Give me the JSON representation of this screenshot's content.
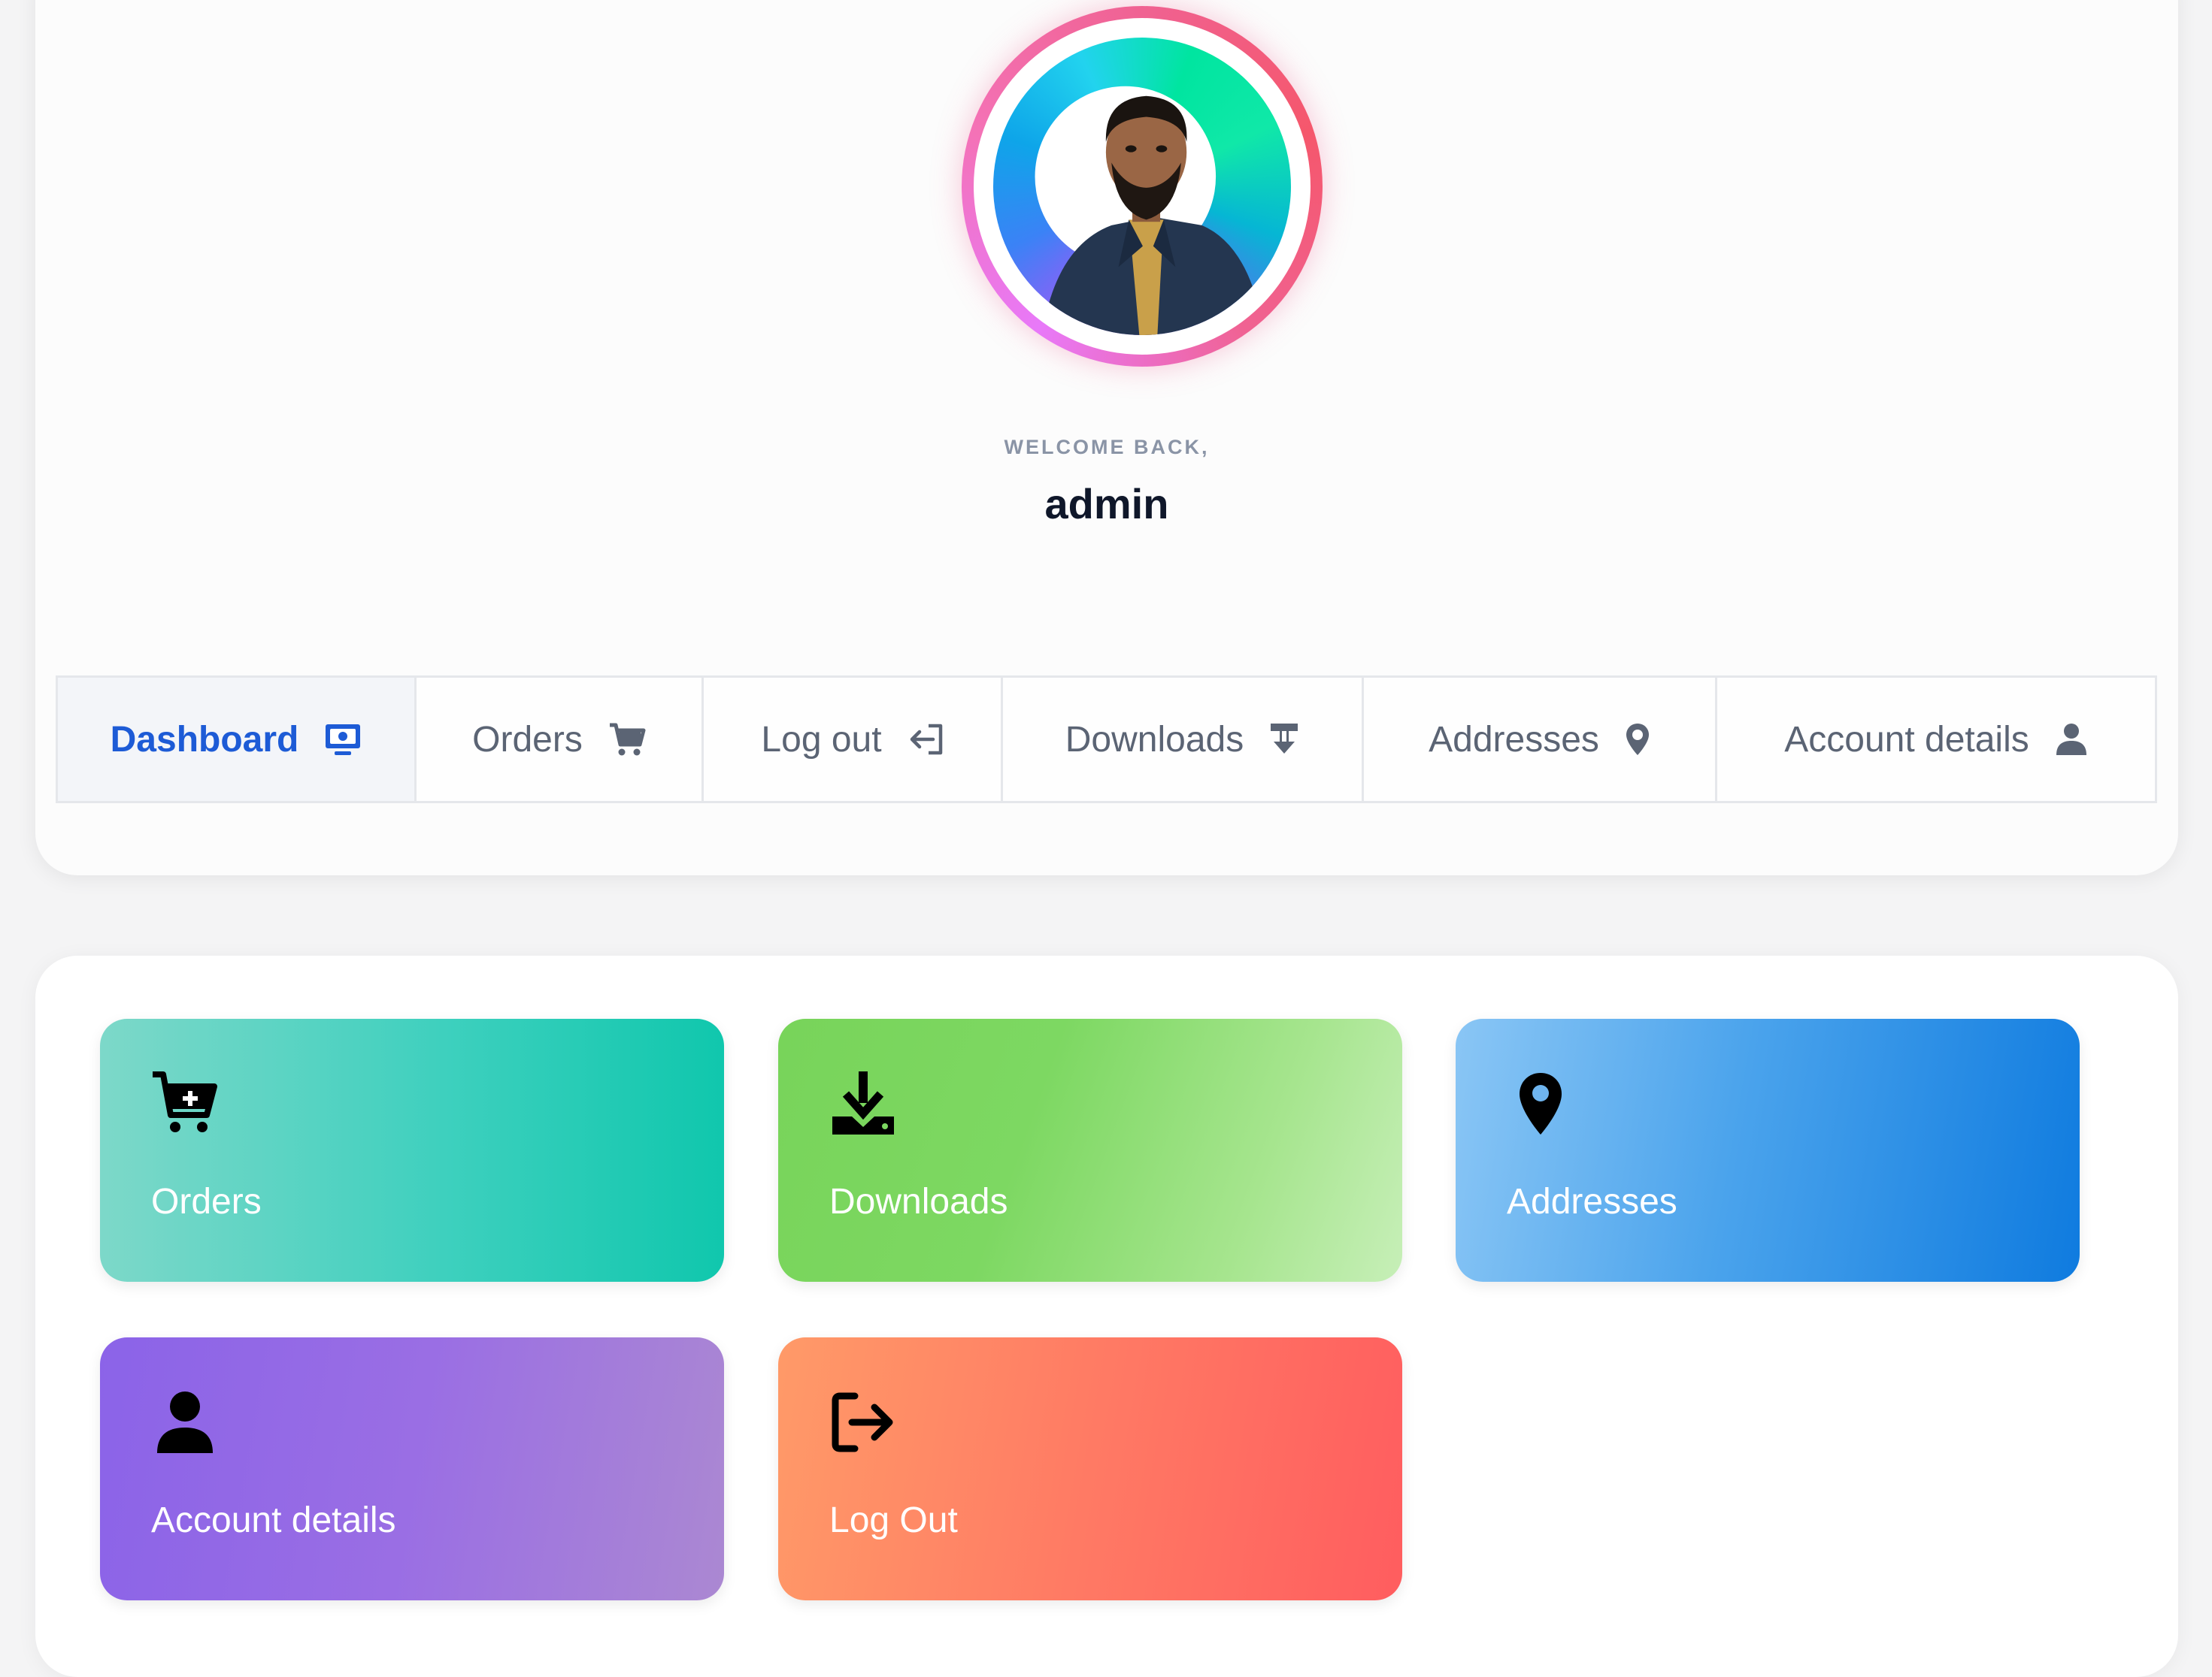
{
  "profile": {
    "welcome_label": "WELCOME BACK,",
    "username": "admin"
  },
  "tabs": [
    {
      "label": "Dashboard",
      "icon": "monitor-icon",
      "active": true
    },
    {
      "label": "Orders",
      "icon": "cart-icon",
      "active": false
    },
    {
      "label": "Log out",
      "icon": "logout-arrow-icon",
      "active": false
    },
    {
      "label": "Downloads",
      "icon": "download-icon",
      "active": false
    },
    {
      "label": "Addresses",
      "icon": "map-pin-icon",
      "active": false
    },
    {
      "label": "Account details",
      "icon": "user-icon",
      "active": false
    }
  ],
  "tiles": [
    {
      "label": "Orders",
      "icon": "cart-plus-icon"
    },
    {
      "label": "Downloads",
      "icon": "download-icon"
    },
    {
      "label": "Addresses",
      "icon": "map-pin-icon"
    },
    {
      "label": "Account details",
      "icon": "user-icon"
    },
    {
      "label": "Log Out",
      "icon": "sign-out-icon"
    }
  ],
  "colors": {
    "active_tab": "#1d5bd6",
    "tab_text": "#5b6474",
    "orders_tile": "#10c7ad",
    "downloads_tile": "#7dd862",
    "addresses_tile": "#0f7bdf",
    "account_tile": "#9a6ee4",
    "logout_tile": "#ff5d5f"
  }
}
